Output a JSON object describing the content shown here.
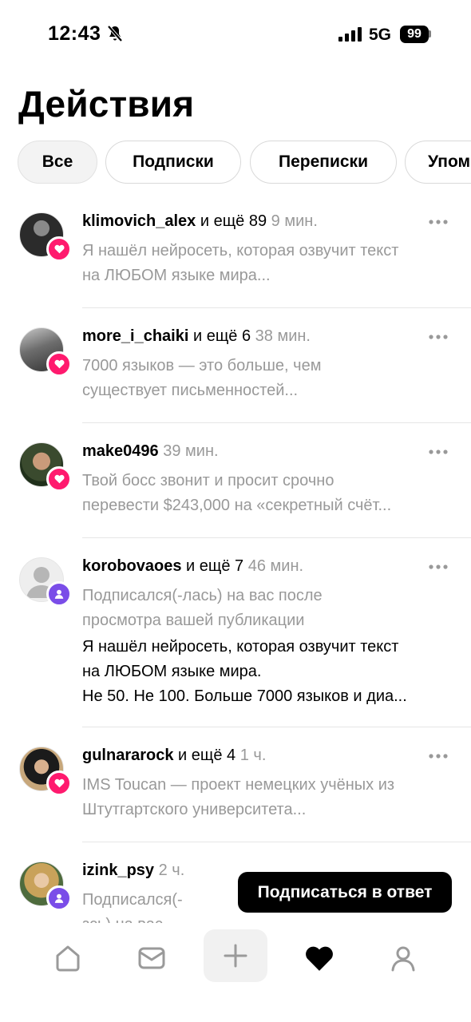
{
  "status_bar": {
    "time": "12:43",
    "network": "5G",
    "battery": "99",
    "icons": [
      "bell-slash-icon",
      "signal-icon"
    ]
  },
  "header": {
    "title": "Действия"
  },
  "tabs": [
    {
      "label": "Все",
      "active": true
    },
    {
      "label": "Подписки",
      "active": false
    },
    {
      "label": "Переписки",
      "active": false
    },
    {
      "label": "Упом",
      "active": false
    }
  ],
  "activities": [
    {
      "user": "klimovich_alex",
      "extra": " и ещё 89",
      "time": "9 мин.",
      "badge": "like",
      "lines": [
        "Я нашёл нейросеть, которая озвучит текст",
        "на ЛЮБОМ языке мира..."
      ]
    },
    {
      "user": "more_i_chaiki",
      "extra": " и ещё 6",
      "time": "38 мин.",
      "badge": "like",
      "lines": [
        "7000 языков — это больше, чем",
        "существует письменностей..."
      ]
    },
    {
      "user": "make0496",
      "extra": "",
      "time": "39 мин.",
      "badge": "like",
      "lines": [
        "Твой босс звонит и просит срочно",
        "перевести $243,000 на «секретный счёт..."
      ]
    },
    {
      "user": "korobovaoes",
      "extra": " и ещё 7",
      "time": "46 мин.",
      "badge": "follow",
      "lines": [
        "Подписался(-лась) на вас после",
        "просмотра вашей публикации"
      ],
      "dark_lines": [
        "Я нашёл нейросеть, которая озвучит текст",
        "на ЛЮБОМ языке мира.",
        "Не 50. Не 100. Больше 7000 языков и диа..."
      ]
    },
    {
      "user": "gulnararock",
      "extra": " и ещё 4",
      "time": "1 ч.",
      "badge": "like",
      "lines": [
        "IMS Toucan — проект немецких учёных из",
        "Штутгартского университета..."
      ]
    },
    {
      "user": "izink_psy",
      "extra": "",
      "time": "2 ч.",
      "badge": "follow",
      "lines": [
        "Подписался(-",
        "зсь) на вас"
      ]
    }
  ],
  "follow_back_button": "Подписаться в ответ",
  "nav": [
    "home-icon",
    "messages-icon",
    "create-icon",
    "heart-icon",
    "profile-icon"
  ],
  "colors": {
    "like": "#ff1a6e",
    "follow": "#7a4de8",
    "muted_text": "#999999"
  }
}
